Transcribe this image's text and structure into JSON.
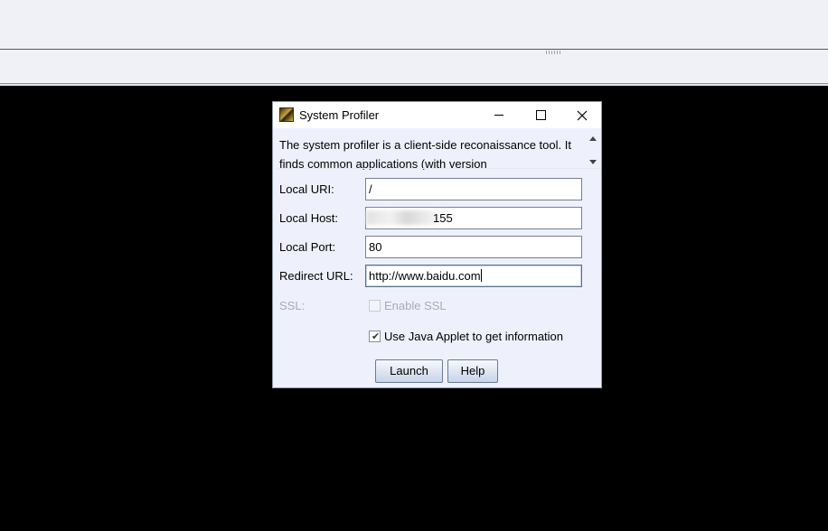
{
  "window": {
    "title": "System Profiler",
    "icon": "app-icon"
  },
  "description": {
    "text": "The system profiler is a client-side reconaissance tool. It finds common applications (with version"
  },
  "form": {
    "local_uri": {
      "label": "Local URI:",
      "value": "/"
    },
    "local_host": {
      "label": "Local Host:",
      "value": "155"
    },
    "local_port": {
      "label": "Local Port:",
      "value": "80"
    },
    "redirect_url": {
      "label": "Redirect URL:",
      "value": "http://www.baidu.com"
    },
    "ssl": {
      "label": "SSL:",
      "checkbox_label": "Enable SSL",
      "checked": false,
      "enabled": false
    },
    "java_applet": {
      "checkbox_label": "Use Java Applet to get information",
      "checked": true
    }
  },
  "buttons": {
    "launch": "Launch",
    "help": "Help"
  },
  "colors": {
    "desktop": "#000000",
    "window_bg": "#eef1fb",
    "toolbar_bg": "#f0f1f7"
  }
}
